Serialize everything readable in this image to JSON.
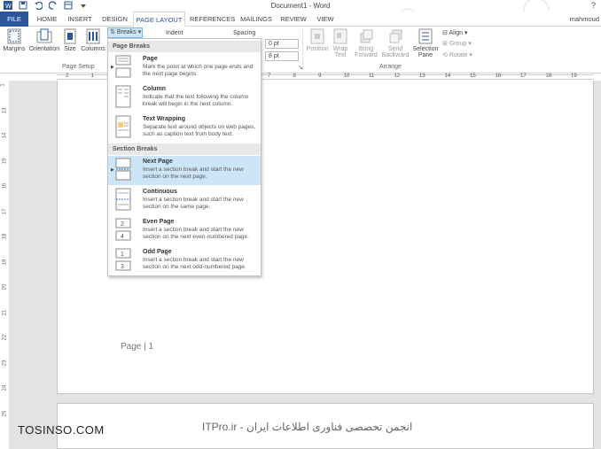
{
  "window": {
    "title": "Document1 - Word",
    "help": "?"
  },
  "user": {
    "name": "mahmoud"
  },
  "tabs": [
    "FILE",
    "HOME",
    "INSERT",
    "DESIGN",
    "PAGE LAYOUT",
    "REFERENCES",
    "MAILINGS",
    "REVIEW",
    "VIEW"
  ],
  "active_tab": "PAGE LAYOUT",
  "ribbon": {
    "margins": "Margins",
    "orientation": "Orientation",
    "size": "Size",
    "columns": "Columns",
    "breaks": "Breaks",
    "page_setup_label": "Page Setup",
    "indent": "Indent",
    "spacing": "Spacing",
    "spacing_before": "0 pt",
    "spacing_after": "8 pt",
    "position": "Position",
    "wrap_text_1": "Wrap",
    "wrap_text_2": "Text",
    "bring_forward_1": "Bring",
    "bring_forward_2": "Forward",
    "send_backward_1": "Send",
    "send_backward_2": "Backward",
    "selection_pane_1": "Selection",
    "selection_pane_2": "Pane",
    "align": "Align",
    "group": "Group",
    "rotate": "Rotate",
    "arrange_label": "Arrange"
  },
  "ruler": {
    "numbers": [
      "2",
      "1",
      "1",
      "2",
      "3",
      "4",
      "5",
      "6",
      "7",
      "8",
      "9",
      "10",
      "11",
      "12",
      "13",
      "14",
      "15",
      "16",
      "17",
      "18",
      "19"
    ]
  },
  "vruler": {
    "numbers": [
      "1",
      "13",
      "14",
      "15",
      "16",
      "17",
      "18",
      "19",
      "20",
      "21",
      "22",
      "23",
      "24",
      "25"
    ]
  },
  "breaks_menu": {
    "page_breaks_header": "Page Breaks",
    "section_breaks_header": "Section Breaks",
    "items": [
      {
        "title": "Page",
        "desc": "Mark the point at which one page ends and the next page begins."
      },
      {
        "title": "Column",
        "desc": "Indicate that the text following the column break will begin in the next column."
      },
      {
        "title": "Text Wrapping",
        "desc": "Separate text around objects on web pages, such as caption text from body text."
      },
      {
        "title": "Next Page",
        "desc": "Insert a section break and start the new section on the next page."
      },
      {
        "title": "Continuous",
        "desc": "Insert a section break and start the new section on the same page."
      },
      {
        "title": "Even Page",
        "desc": "Insert a section break and start the new section on the next even-numbered page."
      },
      {
        "title": "Odd Page",
        "desc": "Insert a section break and start the new section on the next odd-numbered page."
      }
    ],
    "selected": "Next Page"
  },
  "document": {
    "footer": "Page | 1"
  },
  "watermark": {
    "left": "TOSINSO.COM",
    "right": "ITPro.ir - انجمن تخصصی فناوری اطلاعات ایران"
  },
  "colors": {
    "accent": "#2b579a",
    "selected": "#cde6f7"
  }
}
